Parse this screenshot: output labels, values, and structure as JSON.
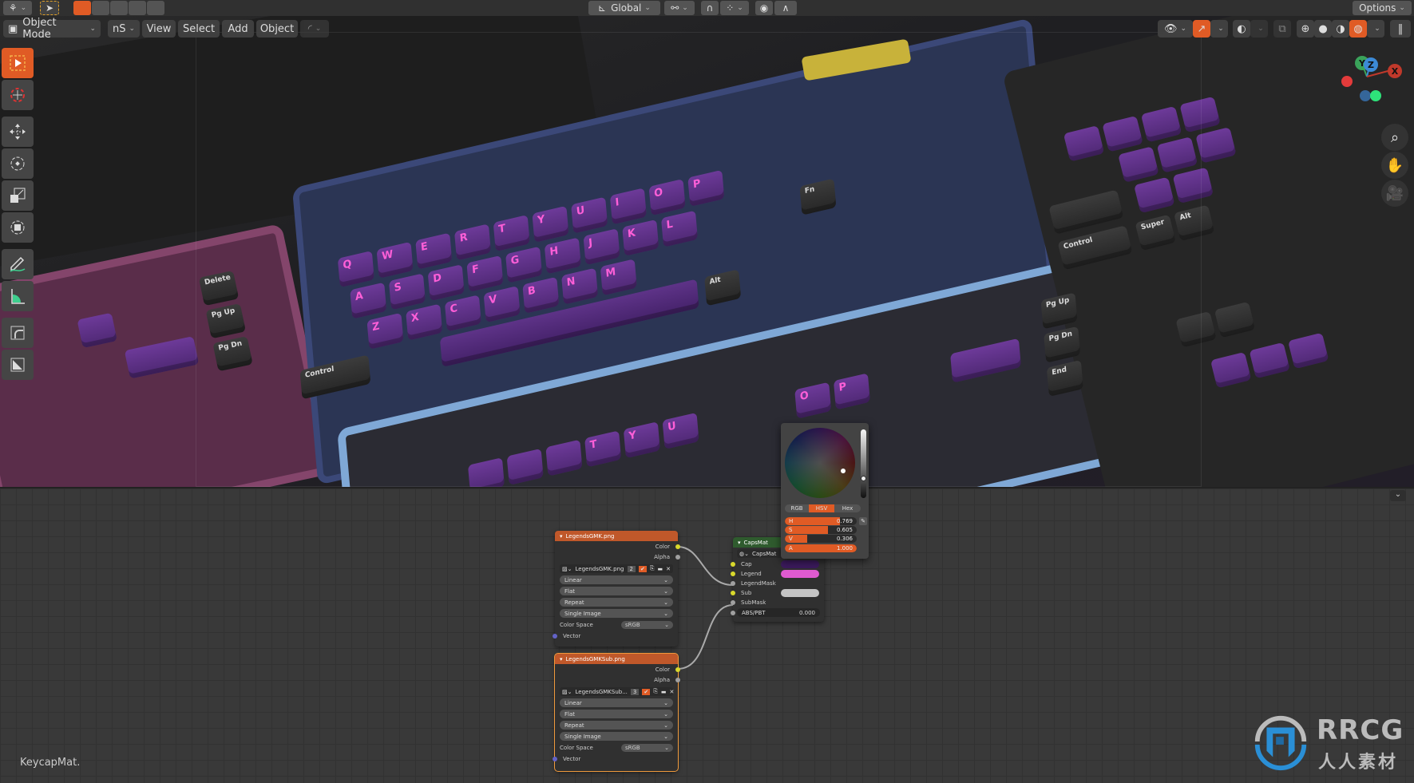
{
  "header": {
    "transform_orientation": "Global",
    "options_label": "Options"
  },
  "viewport_header": {
    "mode": "Object Mode",
    "view_layer_short": "nS",
    "menus": [
      "View",
      "Select",
      "Add",
      "Object"
    ]
  },
  "toolbar": {
    "tools": [
      "select-box",
      "cursor",
      "move",
      "rotate",
      "scale",
      "transform",
      "annotate",
      "measure",
      "add-cube-corner",
      "add-primitive"
    ],
    "active_tool": "select-box"
  },
  "gizmo": {
    "x": "X",
    "y": "Y",
    "z": "Z"
  },
  "viewport_keys": {
    "alpha": [
      "Q",
      "W",
      "E",
      "R",
      "T",
      "Y",
      "U",
      "I",
      "O",
      "P",
      "A",
      "S",
      "D",
      "F",
      "G",
      "H",
      "J",
      "K",
      "L",
      "Z",
      "X",
      "C",
      "V",
      "B",
      "N",
      "M"
    ],
    "mods": [
      "Control",
      "Super",
      "Alt",
      "Fn",
      "Delete",
      "Pg Up",
      "Pg Dn",
      "End"
    ]
  },
  "node_editor": {
    "material_name": "KeycapMat.",
    "nodes": [
      {
        "title": "LegendsGMK.png",
        "outputs": [
          "Color",
          "Alpha"
        ],
        "image_name": "LegendsGMK.png",
        "users": "2",
        "interpolation": "Linear",
        "projection": "Flat",
        "extension": "Repeat",
        "source": "Single Image",
        "color_space_label": "Color Space",
        "color_space": "sRGB",
        "input": "Vector"
      },
      {
        "title": "LegendsGMKSub.png",
        "outputs": [
          "Color",
          "Alpha"
        ],
        "image_name": "LegendsGMKSub...",
        "users": "3",
        "interpolation": "Linear",
        "projection": "Flat",
        "extension": "Repeat",
        "source": "Single Image",
        "color_space_label": "Color Space",
        "color_space": "sRGB",
        "input": "Vector"
      },
      {
        "title": "CapsMat",
        "group_name": "CapsMat",
        "inputs": [
          {
            "label": "Cap",
            "color": "#3b1a5c"
          },
          {
            "label": "Legend",
            "color": "#e05ad0"
          },
          {
            "label": "LegendMask"
          },
          {
            "label": "Sub",
            "color": "#c4c4c4"
          },
          {
            "label": "SubMask"
          }
        ],
        "abs_pbt_label": "ABS/PBT",
        "abs_pbt_value": "0.000"
      }
    ]
  },
  "color_picker": {
    "modes": [
      "RGB",
      "HSV",
      "Hex"
    ],
    "active_mode": "HSV",
    "fields": [
      {
        "label": "H",
        "value": "0.769",
        "fraction": 0.769
      },
      {
        "label": "S",
        "value": "0.605",
        "fraction": 0.605
      },
      {
        "label": "V",
        "value": "0.306",
        "fraction": 0.306
      },
      {
        "label": "A",
        "value": "1.000",
        "fraction": 1.0
      }
    ]
  },
  "watermark": {
    "brand": "RRCG",
    "subtitle": "人人素材"
  },
  "colors": {
    "accent": "#e05b25",
    "node_header_image": "#c0582a",
    "node_header_group": "#2f5b2e"
  }
}
